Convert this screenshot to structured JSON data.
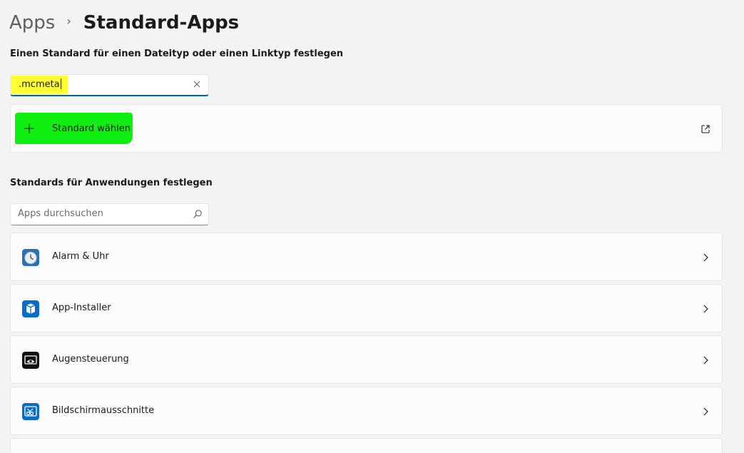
{
  "breadcrumb": {
    "parent": "Apps",
    "separator": "›",
    "current": "Standard-Apps"
  },
  "filetype_section": {
    "label": "Einen Standard für einen Dateityp oder einen Linktyp festlegen",
    "input_value": ".mcmeta",
    "choose_label": "Standard wählen",
    "highlight_input_color": "#ffff33",
    "highlight_choose_color": "#11ee11"
  },
  "apps_section": {
    "label": "Standards für Anwendungen festlegen",
    "search_placeholder": "Apps durchsuchen",
    "apps": [
      {
        "name": "Alarm & Uhr",
        "icon": "clock-icon"
      },
      {
        "name": "App-Installer",
        "icon": "box-icon"
      },
      {
        "name": "Augensteuerung",
        "icon": "eye-icon"
      },
      {
        "name": "Bildschirmausschnitte",
        "icon": "scissors-icon"
      }
    ]
  },
  "colors": {
    "accent": "#005fb8",
    "app_icon_blue": "#0a6cc9"
  }
}
